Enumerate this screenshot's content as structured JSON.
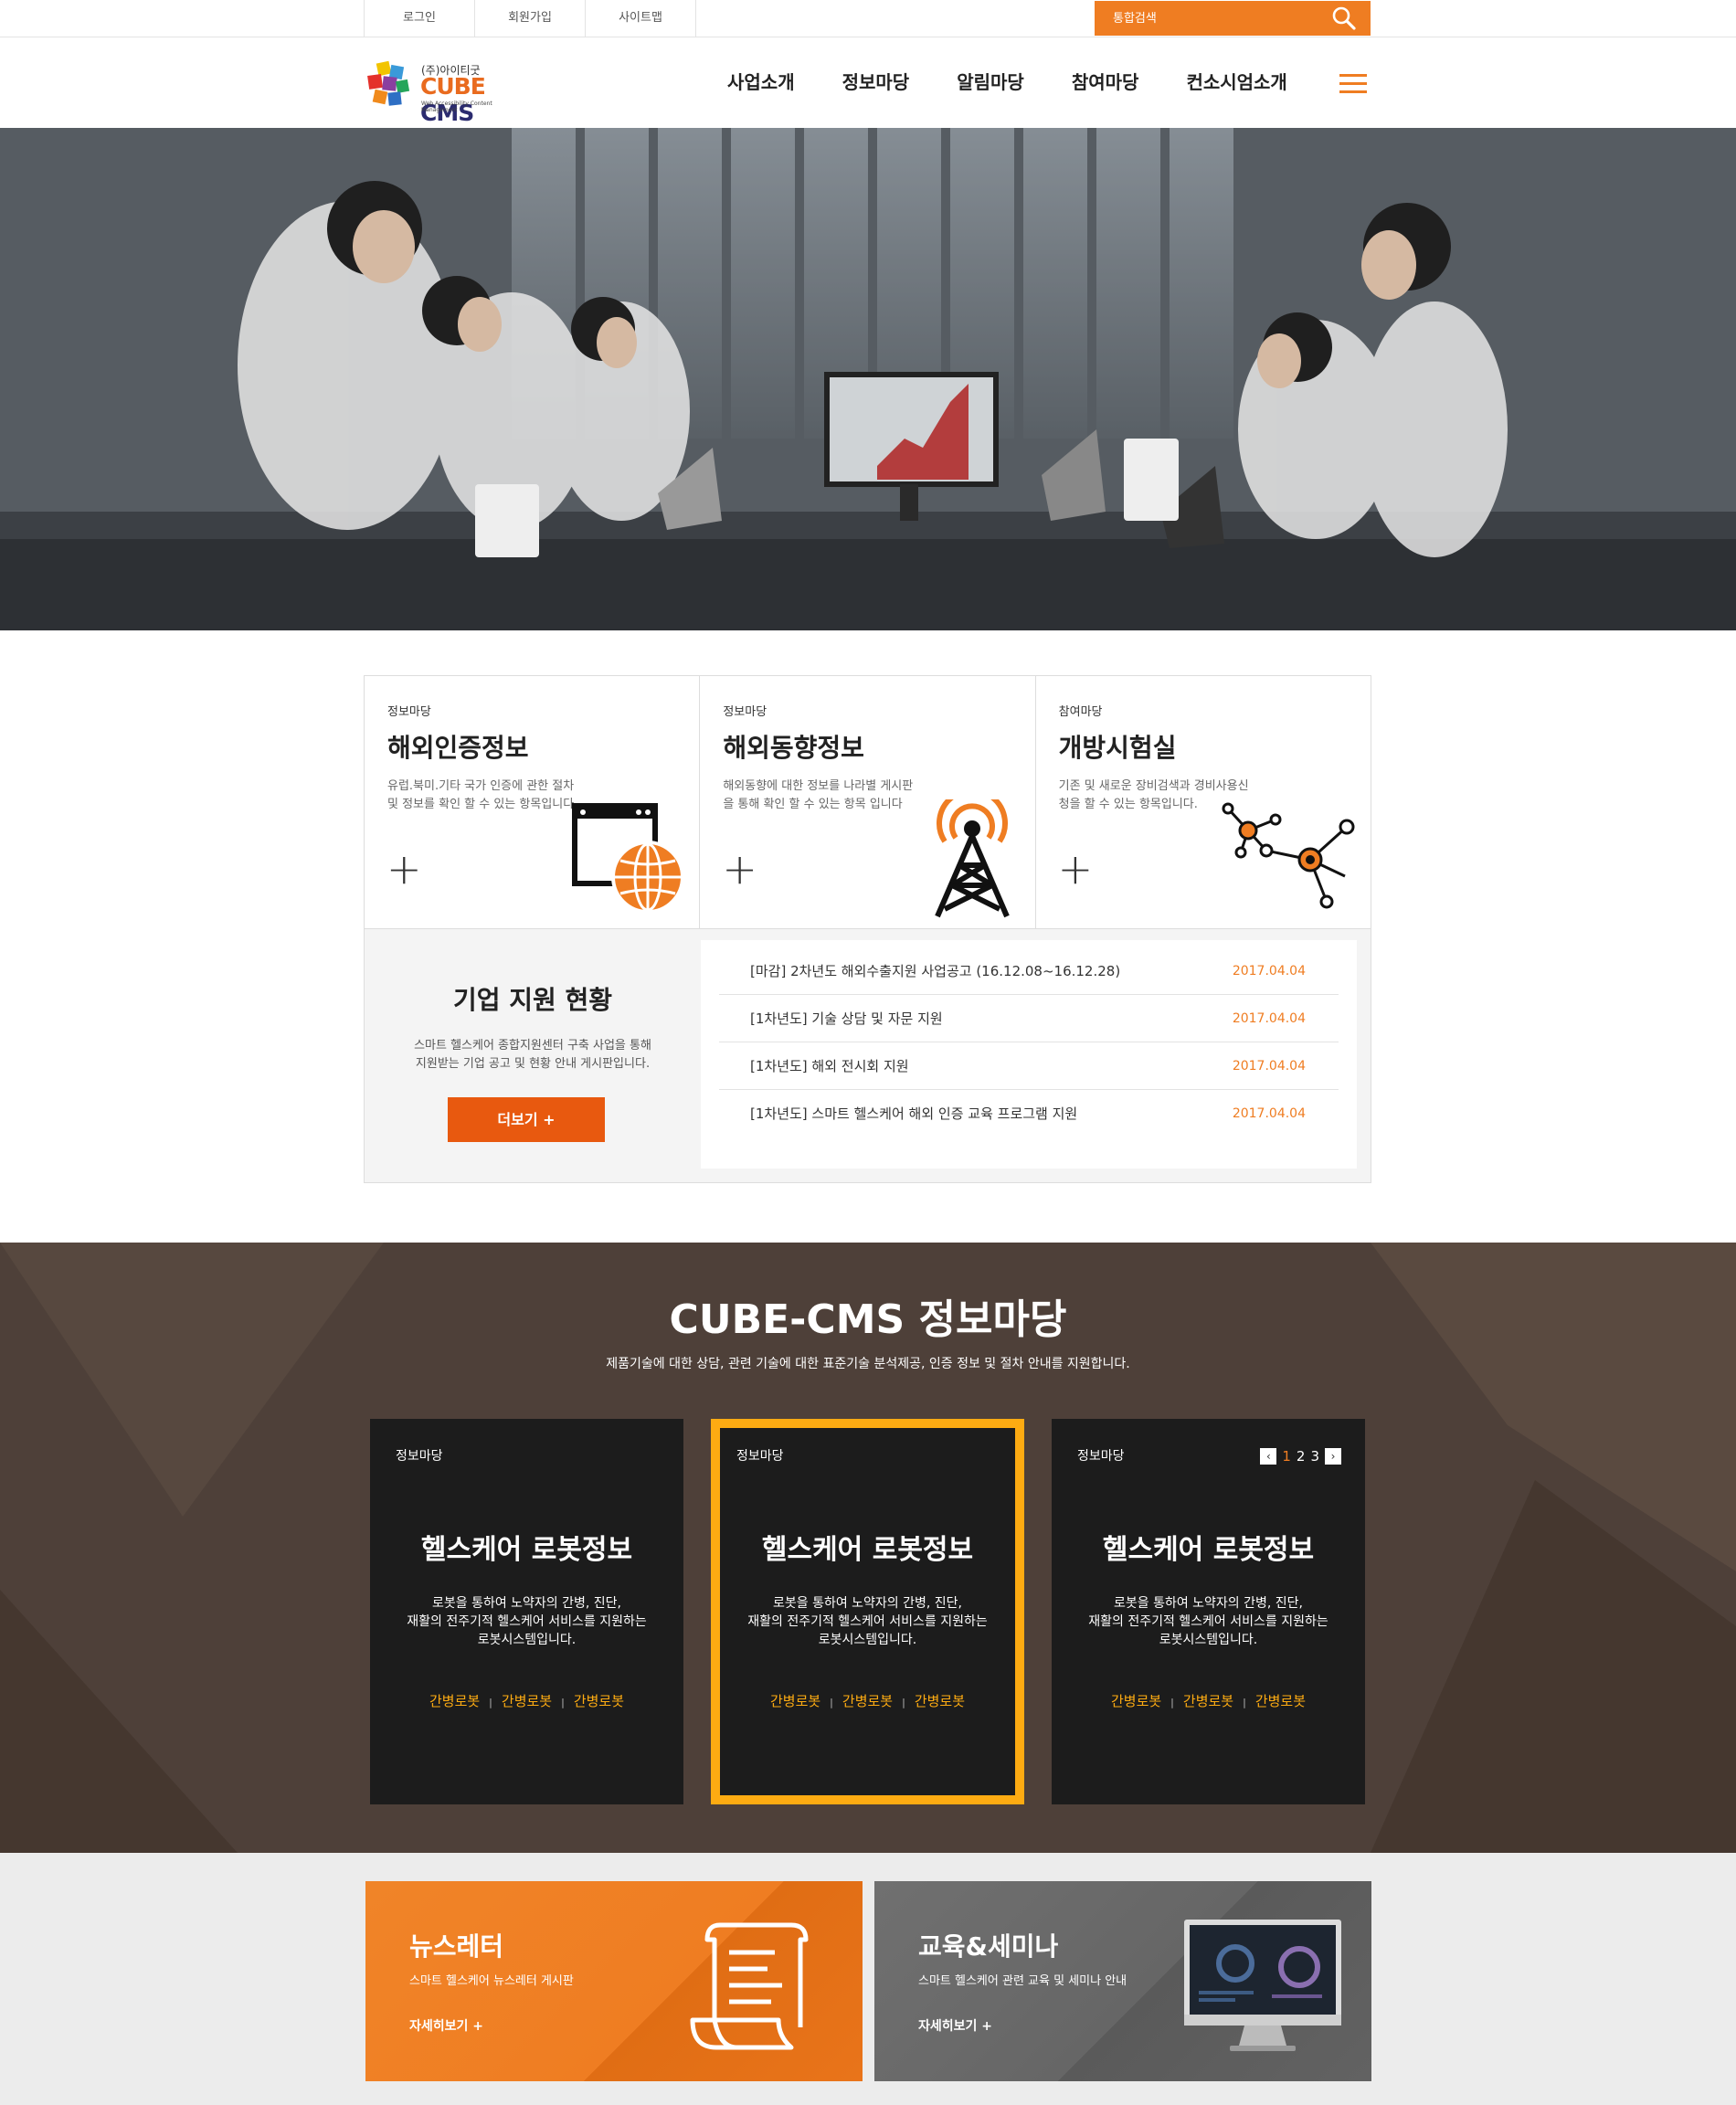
{
  "topbar": {
    "links": [
      "로그인",
      "회원가입",
      "사이트맵"
    ],
    "search_placeholder": "통합검색"
  },
  "logo": {
    "sub": "(주)아이티굿",
    "brand_a": "CUBE",
    "brand_b": "CMS",
    "tagline": "Web Accessibility Content Management"
  },
  "nav": [
    "사업소개",
    "정보마당",
    "알림마당",
    "참여마당",
    "컨소시엄소개"
  ],
  "cards": [
    {
      "cat": "정보마당",
      "title": "해외인증정보",
      "desc": "유럽.북미.기타 국가 인증에 관한 절차 및 정보를 확인 할 수 있는 항목입니다",
      "icon": "globe-window-icon"
    },
    {
      "cat": "정보마당",
      "title": "해외동향정보",
      "desc": "해외동향에 대한 정보를 나라별 게시판을 통해 확인 할 수 있는 항목 입니다",
      "icon": "antenna-tower-icon"
    },
    {
      "cat": "참여마당",
      "title": "개방시험실",
      "desc": "기존 및 새로운 장비검색과 경비사용신청을 할 수 있는 항목입니다.",
      "icon": "network-nodes-icon"
    }
  ],
  "support": {
    "title": "기업 지원 현황",
    "desc1": "스마트 헬스케어 종합지원센터 구축 사업을 통해",
    "desc2": "지원받는 기업 공고 및 현황 안내 게시판입니다.",
    "more": "더보기  +",
    "items": [
      {
        "title": "[마감] 2차년도 해외수출지원 사업공고 (16.12.08~16.12.28)",
        "date": "2017.04.04"
      },
      {
        "title": "[1차년도] 기술 상담 및 자문 지원",
        "date": "2017.04.04"
      },
      {
        "title": "[1차년도] 해외 전시회 지원",
        "date": "2017.04.04"
      },
      {
        "title": "[1차년도] 스마트 헬스케어 해외 인증 교육 프로그램 지원",
        "date": "2017.04.04"
      }
    ]
  },
  "info": {
    "title": "CUBE-CMS 정보마당",
    "lead": "제품기술에 대한 상담, 관련 기술에 대한 표준기술 분석제공, 인증 정보 및 절차 안내를 지원합니다.",
    "panels": [
      {
        "cat": "정보마당",
        "title": "헬스케어 로봇정보",
        "d1": "로봇을 통하여 노약자의 간병, 진단,",
        "d2": "재활의 전주기적 헬스케어 서비스를 지원하는",
        "d3": "로봇시스템입니다.",
        "tags": [
          "간병로봇",
          "간병로봇",
          "간병로봇"
        ]
      },
      {
        "cat": "정보마당",
        "title": "헬스케어 로봇정보",
        "d1": "로봇을 통하여 노약자의 간병, 진단,",
        "d2": "재활의 전주기적 헬스케어 서비스를 지원하는",
        "d3": "로봇시스템입니다.",
        "tags": [
          "간병로봇",
          "간병로봇",
          "간병로봇"
        ]
      },
      {
        "cat": "정보마당",
        "title": "헬스케어 로봇정보",
        "d1": "로봇을 통하여 노약자의 간병, 진단,",
        "d2": "재활의 전주기적 헬스케어 서비스를 지원하는",
        "d3": "로봇시스템입니다.",
        "tags": [
          "간병로봇",
          "간병로봇",
          "간병로봇"
        ]
      }
    ],
    "pager": {
      "prev": "‹",
      "pages": [
        "1",
        "2",
        "3"
      ],
      "current": "1",
      "next": "›"
    }
  },
  "bottom": [
    {
      "title": "뉴스레터",
      "desc": "스마트 헬스케어 뉴스레터 게시판",
      "go": "자세히보기  +",
      "color": "#ef7d22"
    },
    {
      "title": "교육&세미나",
      "desc": "스마트 헬스케어 관련 교육 및 세미나 안내",
      "go": "자세히보기  +",
      "color": "#6b6b6b"
    }
  ]
}
